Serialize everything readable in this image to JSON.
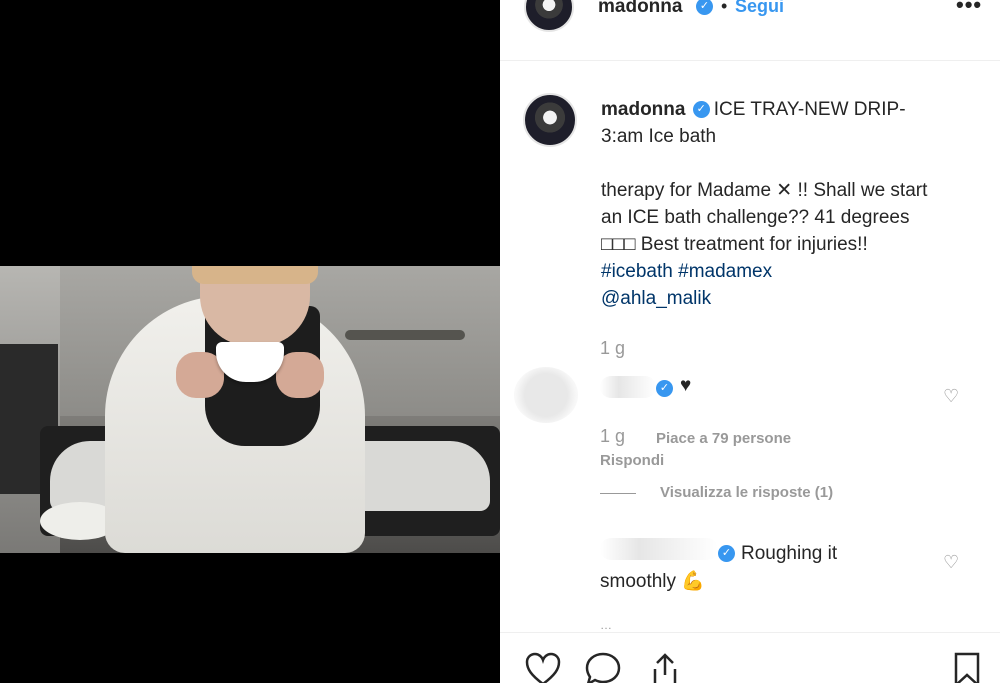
{
  "post": {
    "username": "madonna",
    "follow_label": "Segui",
    "more_label": "•••",
    "verified_mark": "✓",
    "separator": "•"
  },
  "caption": {
    "username": "madonna",
    "lines": [
      "ICE TRAY-NEW DRIP-",
      "3:am Ice bath"
    ],
    "text_para": "therapy for Madame ✕ !! Shall we start an ICE bath challenge?? 41 degrees □□□ Best treatment for injuries!!",
    "hashtags": [
      "#icebath",
      "#madamex"
    ],
    "mention": "@ahla_malik",
    "time": "1 g"
  },
  "comments": [
    {
      "text": "♥",
      "time": "1 g",
      "likes": "Piace a 79 persone",
      "reply_label": "Rispondi",
      "view_replies": "Visualizza le risposte (1)"
    },
    {
      "suffix": "Roughing it",
      "text": "smoothly 💪",
      "more": "…"
    }
  ],
  "icons": {
    "like": "heart-icon",
    "comment": "comment-icon",
    "share": "share-icon",
    "save": "bookmark-icon"
  }
}
